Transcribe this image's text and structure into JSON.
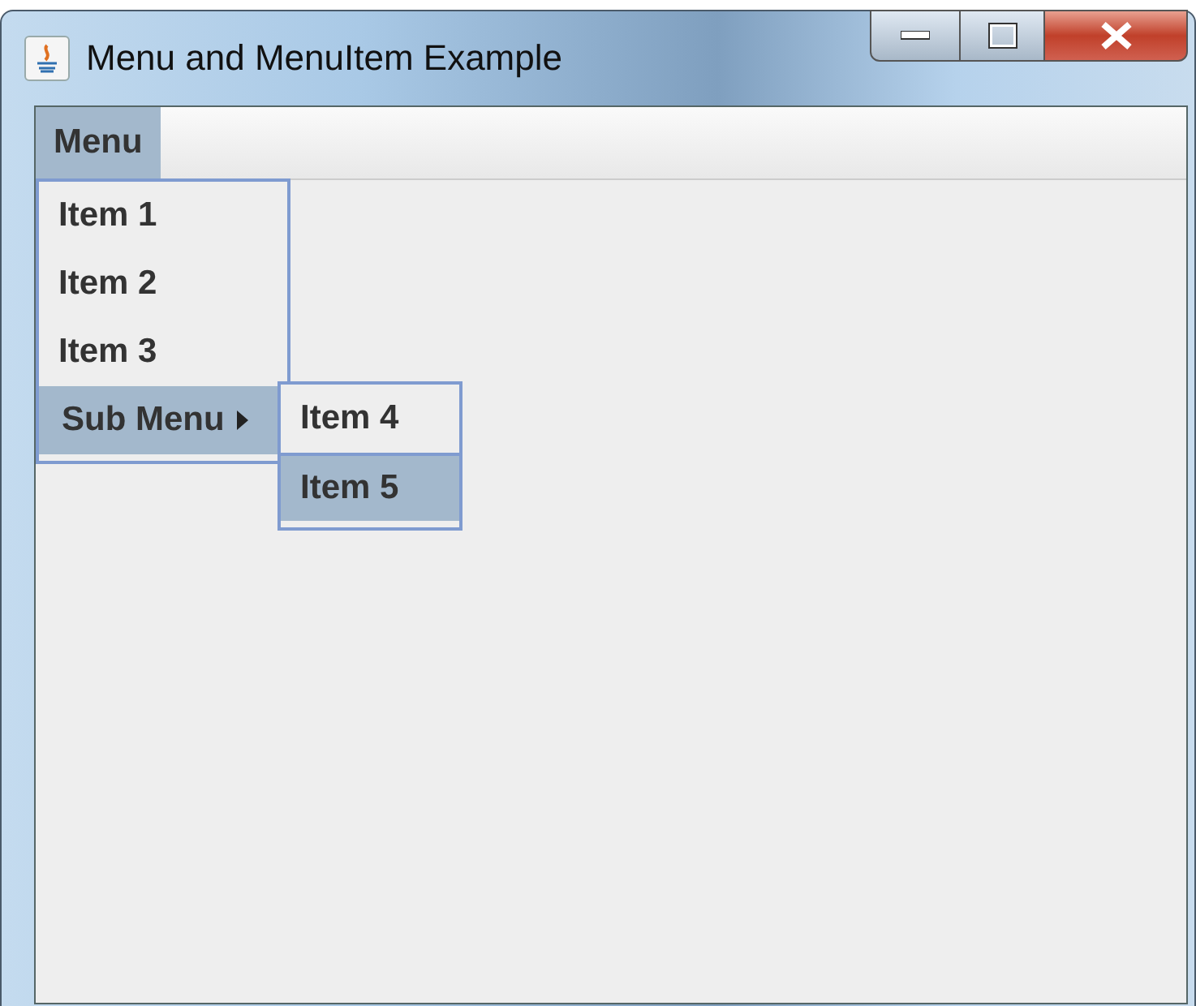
{
  "window": {
    "title": "Menu and MenuItem Example"
  },
  "menubar": {
    "menus": [
      {
        "label": "Menu",
        "selected": true
      }
    ]
  },
  "menu": {
    "items": [
      {
        "label": "Item 1",
        "kind": "item",
        "selected": false
      },
      {
        "label": "Item 2",
        "kind": "item",
        "selected": false
      },
      {
        "label": "Item 3",
        "kind": "item",
        "selected": false
      },
      {
        "label": "Sub Menu",
        "kind": "submenu",
        "selected": true
      }
    ]
  },
  "submenu": {
    "items": [
      {
        "label": "Item 4",
        "selected": false
      },
      {
        "label": "Item 5",
        "selected": true
      }
    ]
  }
}
